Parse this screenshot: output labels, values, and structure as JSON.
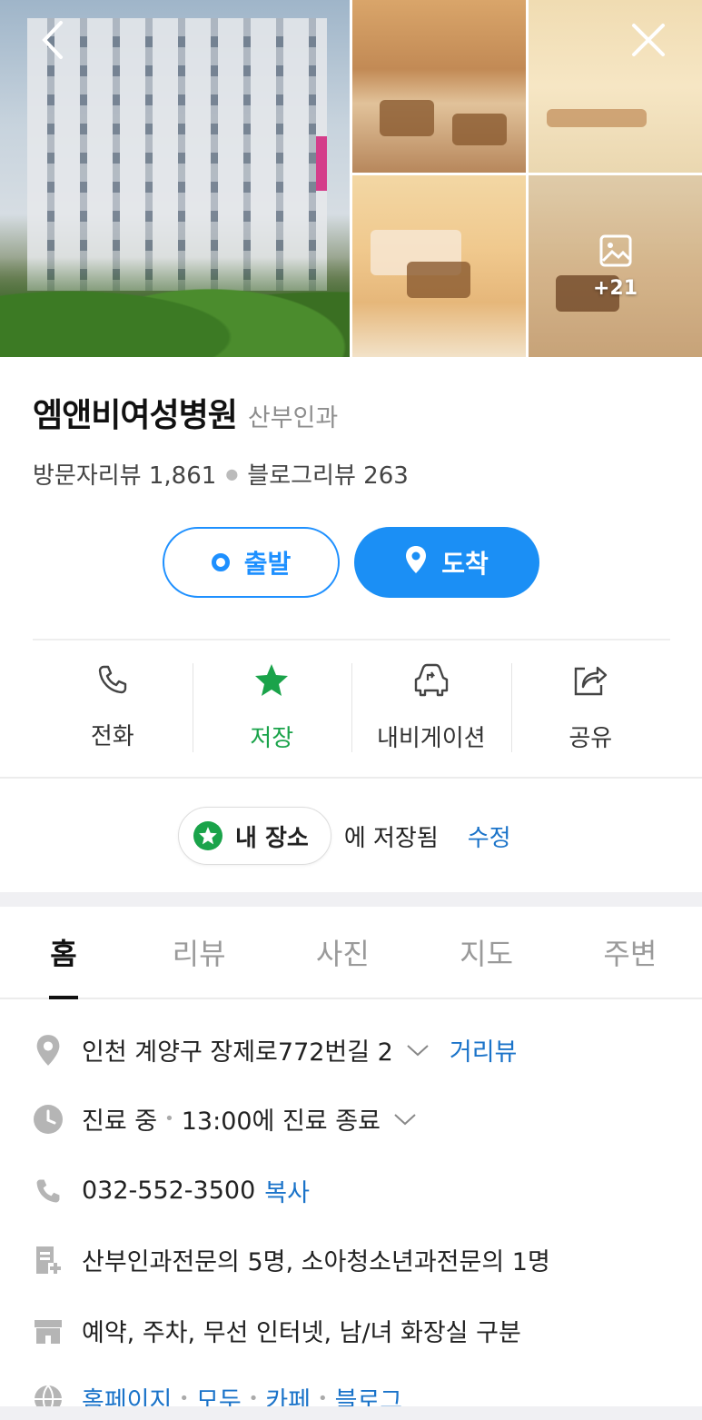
{
  "photos": {
    "more_count": "+21"
  },
  "place": {
    "name": "엠앤비여성병원",
    "category": "산부인과",
    "visitor_review_label": "방문자리뷰 1,861",
    "blog_review_label": "블로그리뷰 263"
  },
  "route": {
    "start_label": "출발",
    "arrive_label": "도착"
  },
  "actions": [
    {
      "label": "전화",
      "icon": "phone-icon"
    },
    {
      "label": "저장",
      "icon": "star-icon"
    },
    {
      "label": "내비게이션",
      "icon": "car-navigation-icon"
    },
    {
      "label": "공유",
      "icon": "share-icon"
    }
  ],
  "saved": {
    "chip_label": "내 장소",
    "saved_text": "에 저장됨",
    "edit_label": "수정"
  },
  "tabs": [
    {
      "label": "홈",
      "active": true
    },
    {
      "label": "리뷰"
    },
    {
      "label": "사진"
    },
    {
      "label": "지도"
    },
    {
      "label": "주변"
    }
  ],
  "info": {
    "address": "인천 계양구 장제로772번길 2",
    "street_view": "거리뷰",
    "status": "진료 중",
    "hours": "13:00에 진료 종료",
    "phone": "032-552-3500",
    "copy": "복사",
    "doctors": "산부인과전문의 5명, 소아청소년과전문의 1명",
    "amenities": "예약, 주차, 무선 인터넷, 남/녀 화장실 구분",
    "links": [
      "홈페이지",
      "모두",
      "카페",
      "블로그"
    ]
  },
  "colors": {
    "accent_blue": "#1b8ff5",
    "saved_green": "#1aa34a",
    "link_blue": "#1a73c9"
  }
}
